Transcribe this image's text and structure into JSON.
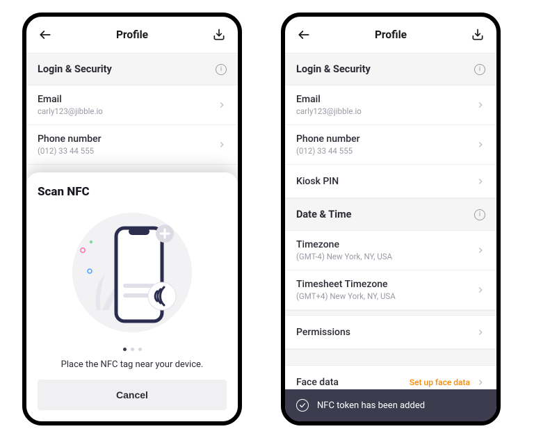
{
  "header": {
    "title": "Profile"
  },
  "security": {
    "title": "Login & Security",
    "email_label": "Email",
    "email_value": "carly123@jibble.io",
    "phone_label": "Phone number",
    "phone_value": "(012) 33 44 555",
    "kiosk_label": "Kiosk PIN"
  },
  "datetime": {
    "title": "Date & Time",
    "tz_label": "Timezone",
    "tz_value": "(GMT-4) New York, NY, USA",
    "sheet_tz_label": "Timesheet Timezone",
    "sheet_tz_value": "(GMT+4) New York, NY, USA"
  },
  "permissions_label": "Permissions",
  "face": {
    "label": "Face data",
    "action": "Set up face data"
  },
  "nfc_sheet": {
    "title": "Scan NFC",
    "instruction": "Place the NFC tag near your device.",
    "cancel": "Cancel"
  },
  "toast": "NFC token has been added"
}
